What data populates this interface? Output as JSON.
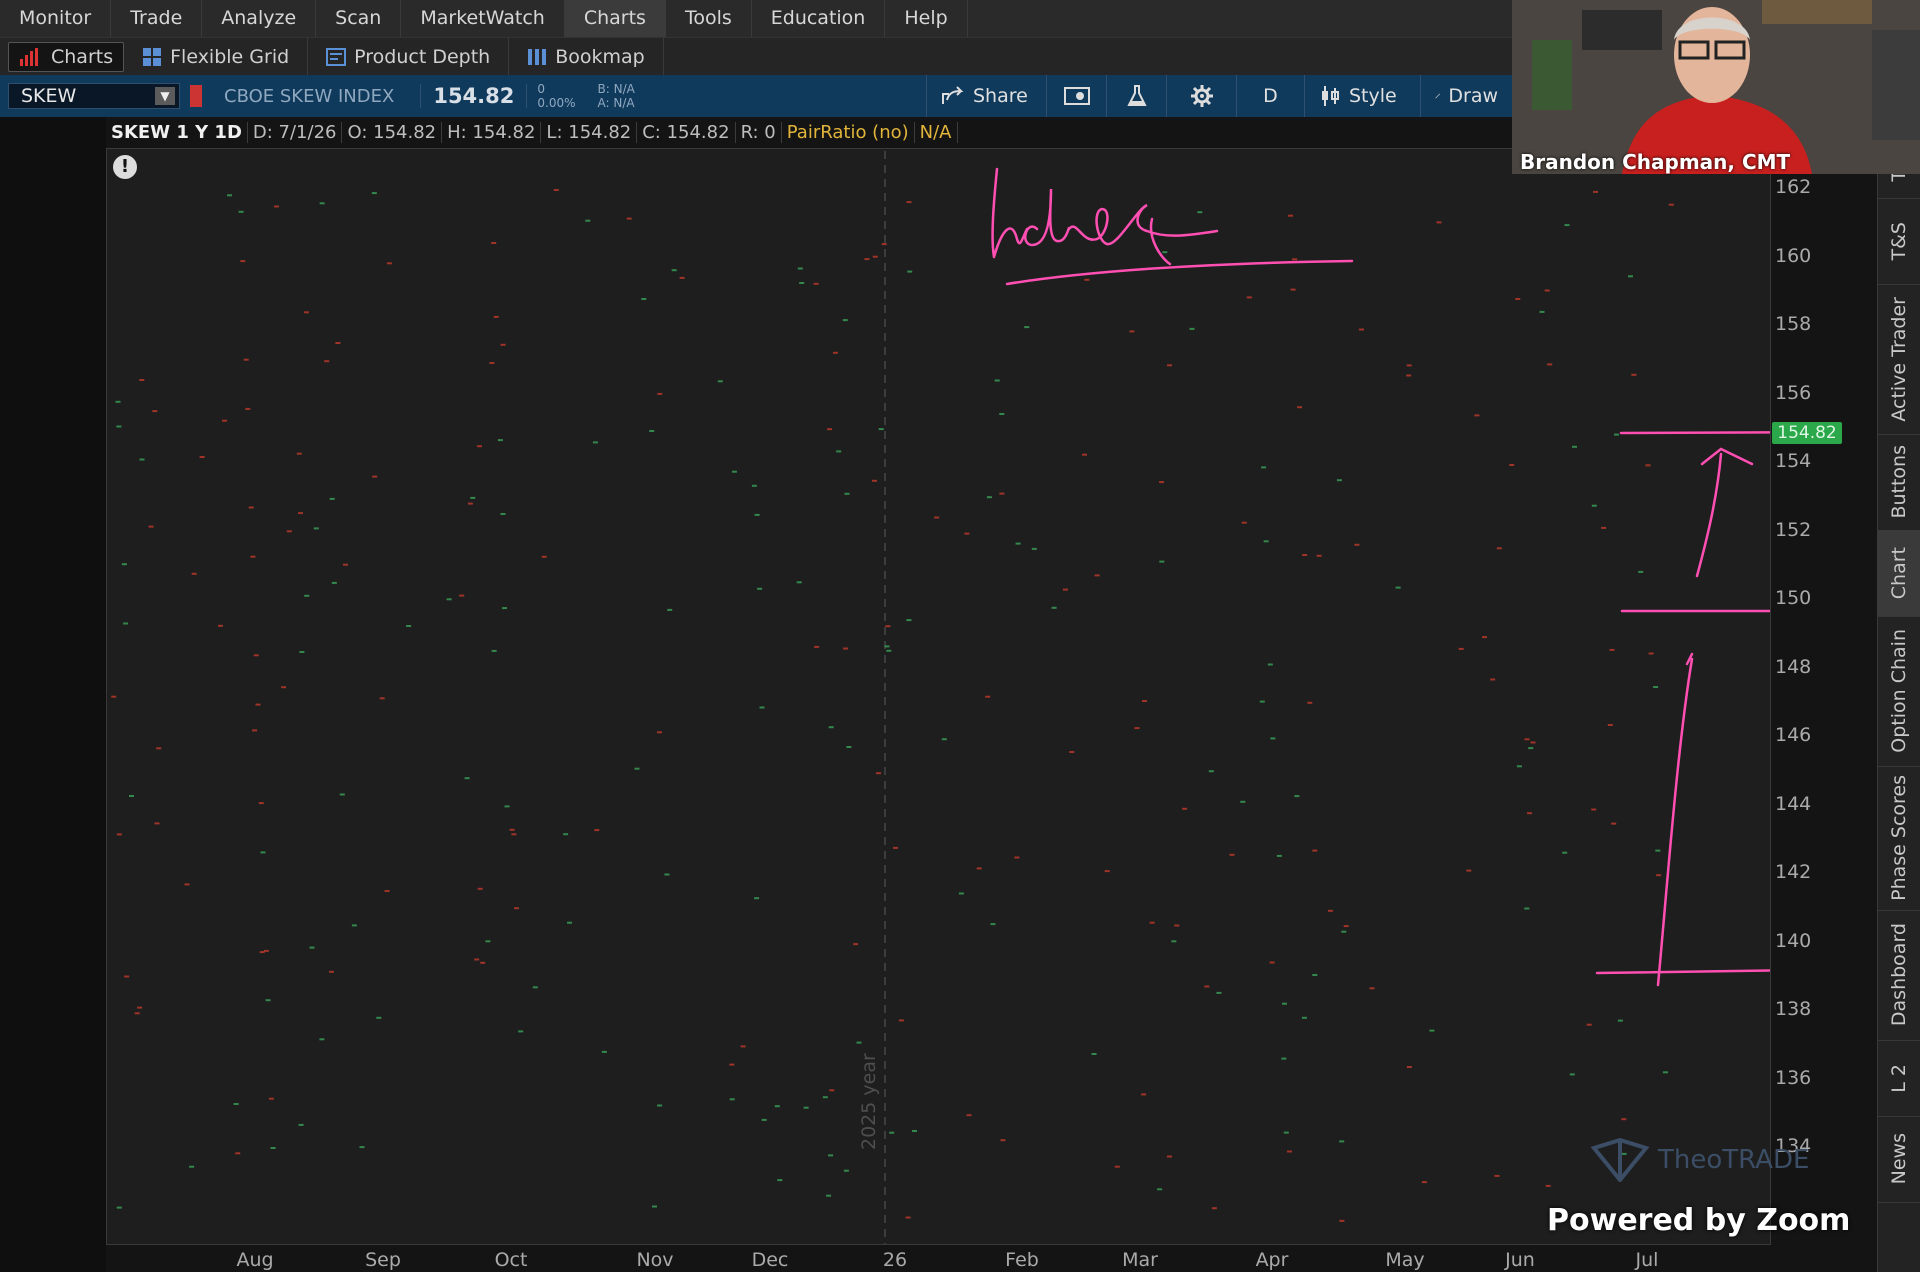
{
  "menu": [
    {
      "label": "Monitor"
    },
    {
      "label": "Trade"
    },
    {
      "label": "Analyze"
    },
    {
      "label": "Scan"
    },
    {
      "label": "MarketWatch"
    },
    {
      "label": "Charts",
      "active": true
    },
    {
      "label": "Tools"
    },
    {
      "label": "Education"
    },
    {
      "label": "Help"
    }
  ],
  "subtoolbar": {
    "charts": "Charts",
    "flexible_grid": "Flexible Grid",
    "product_depth": "Product Depth",
    "bookmap": "Bookmap"
  },
  "symbol_bar": {
    "symbol": "SKEW",
    "name": "CBOE SKEW INDEX",
    "price": "154.82",
    "change": "0",
    "change_pct": "0.00%",
    "bid": "B: N/A",
    "ask": "A: N/A",
    "share": "Share",
    "period": "D",
    "style": "Style",
    "draw": "Draw"
  },
  "info_bar": {
    "symbol": "SKEW 1 Y 1D",
    "date": "D: 7/1/26",
    "open": "O: 154.82",
    "high": "H: 154.82",
    "low": "L: 154.82",
    "close": "C: 154.82",
    "range": "R: 0",
    "pair_ratio": "PairRatio (no)",
    "pair_value": "N/A"
  },
  "chart": {
    "y_ticks": [
      "162",
      "160",
      "158",
      "156",
      "154",
      "152",
      "150",
      "148",
      "146",
      "144",
      "142",
      "140",
      "138",
      "136",
      "134"
    ],
    "x_ticks": [
      "Aug",
      "Sep",
      "Oct",
      "Nov",
      "Dec",
      "26",
      "Feb",
      "Mar",
      "Apr",
      "May",
      "Jun",
      "Jul"
    ],
    "year_label": "2025 year",
    "last_price_tag": "154.82",
    "accent_up": "#3aa35a",
    "accent_down": "#c0392b",
    "annotation_color": "#ff4fb3"
  },
  "side_tabs": [
    "Tr",
    "T&S",
    "Active Trader",
    "Buttons",
    "Chart",
    "Option Chain",
    "Phase Scores",
    "Dashboard",
    "L 2",
    "News"
  ],
  "webcam": {
    "caption": "Brandon Chapman, CMT"
  },
  "overlay": {
    "zoom": "Powered by Zoom",
    "watermark": "TheoTRADE"
  }
}
